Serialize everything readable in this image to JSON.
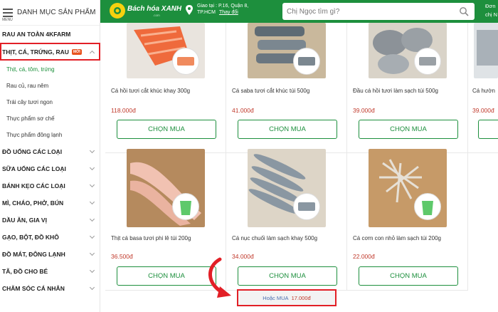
{
  "sidebar": {
    "menu_sub": "MENU",
    "title": "DANH MỤC SẢN PHẨM",
    "items_top": [
      {
        "label": "RAU AN TOÀN 4KFARM"
      }
    ],
    "active_category": {
      "label": "THỊT, CÁ, TRỨNG, RAU",
      "badge": "MỚI"
    },
    "subitems": [
      {
        "label": "Thịt, cá, tôm, trứng"
      },
      {
        "label": "Rau củ, rau nêm"
      },
      {
        "label": "Trái cây tươi ngon"
      },
      {
        "label": "Thực phẩm sơ chế"
      },
      {
        "label": "Thực phẩm đông lạnh"
      }
    ],
    "items": [
      {
        "label": "ĐỒ UỐNG CÁC LOẠI"
      },
      {
        "label": "SỮA UỐNG CÁC LOẠI"
      },
      {
        "label": "BÁNH KẸO CÁC LOẠI"
      },
      {
        "label": "MÌ, CHÁO, PHỞ, BÚN"
      },
      {
        "label": "DẦU ĂN, GIA VỊ"
      },
      {
        "label": "GẠO, BỘT, ĐỒ KHÔ"
      },
      {
        "label": "ĐỒ MÁT, ĐÔNG LẠNH"
      },
      {
        "label": "TÃ, ĐỒ CHO BÉ"
      },
      {
        "label": "CHĂM SÓC CÁ NHÂN"
      }
    ]
  },
  "header": {
    "logo_text": "Bách hóa XANH",
    "logo_sub": ".com",
    "location_line1": "Giao tại : P.16, Quận 8,",
    "location_line2": "TP.HCM",
    "location_change": "Thay đổi",
    "search_placeholder": "Chị Ngọc tìm gì?",
    "right_line1": "Đơn",
    "right_line2": "chị N"
  },
  "products": [
    {
      "name": "Cá hồi tươi cắt khúc khay 300g",
      "price": "118.000đ",
      "buy_label": "CHỌN MUA"
    },
    {
      "name": "Cá saba tươi cắt khúc túi 500g",
      "price": "41.000đ",
      "buy_label": "CHỌN MUA"
    },
    {
      "name": "Đầu cá hồi tươi làm sạch túi 500g",
      "price": "39.000đ",
      "buy_label": "CHỌN MUA"
    },
    {
      "name": "Cá hườn",
      "price": "39.000đ",
      "buy_label": ""
    },
    {
      "name": "Thịt cá basa tươi phi lê túi 200g",
      "price": "36.500đ",
      "buy_label": "CHỌN MUA"
    },
    {
      "name": "Cá nục chuối làm sạch khay 500g",
      "price": "34.000đ",
      "buy_label": "CHỌN MUA"
    },
    {
      "name": "Cá cơm con nhỏ làm sạch túi 200g",
      "price": "22.000đ",
      "buy_label": "CHỌN MUA"
    }
  ],
  "alt_buy": {
    "label": "Hoặc MUA",
    "price": "17.000đ"
  },
  "colors": {
    "brand_green": "#1d8f3d",
    "highlight_red": "#e21f26",
    "price_red": "#c0392b"
  },
  "icons": [
    "menu-icon",
    "logo-icon",
    "location-pin-icon",
    "search-icon",
    "chevron-down-icon",
    "chevron-up-icon",
    "arrow-icon"
  ]
}
